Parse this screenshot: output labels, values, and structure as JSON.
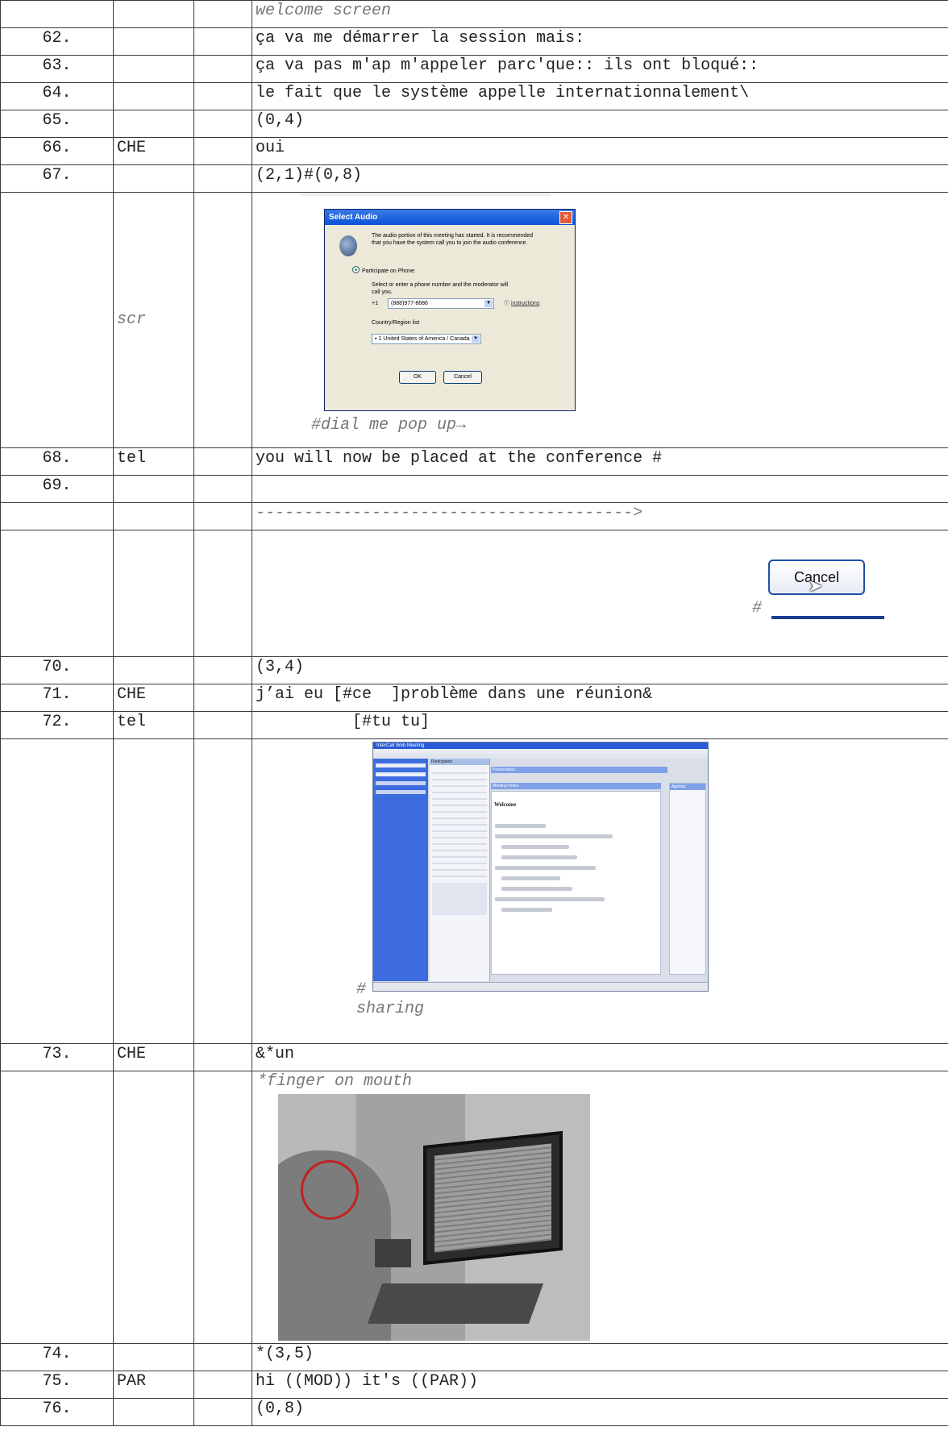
{
  "rows": {
    "r0": {
      "num": "",
      "spk": "",
      "text": "welcome screen"
    },
    "r62": {
      "num": "62.",
      "spk": "",
      "text": "ça va me démarrer la session mais:"
    },
    "r63": {
      "num": "63.",
      "spk": "",
      "text": "ça va pas m'ap m'appeler parc'que:: ils ont bloqué::"
    },
    "r64": {
      "num": "64.",
      "spk": "",
      "text": "le fait que le système appelle internationnalement\\"
    },
    "r65": {
      "num": "65.",
      "spk": "",
      "text": "(0,4)"
    },
    "r66": {
      "num": "66.",
      "spk": "CHE",
      "text": "oui"
    },
    "r67": {
      "num": "67.",
      "spk": "",
      "text": "(2,1)#(0,8)"
    },
    "scr": {
      "spk": "scr",
      "caption": "#dial me pop up→"
    },
    "r68": {
      "num": "68.",
      "spk": "tel",
      "text": "you will now be placed at the conference #"
    },
    "r69": {
      "num": "69.",
      "spk": "",
      "text": ""
    },
    "dash": {
      "text": "--------------------------------------->"
    },
    "cancel_mark": "#",
    "r70": {
      "num": "70.",
      "spk": "",
      "text": "(3,4)"
    },
    "r71": {
      "num": "71.",
      "spk": "CHE",
      "text": "j’ai eu [#ce  ]problème dans une réunion&"
    },
    "r72": {
      "num": "72.",
      "spk": "tel",
      "text": "          [#tu tu]"
    },
    "share": {
      "mark": "#",
      "caption": "sharing"
    },
    "r73": {
      "num": "73.",
      "spk": "CHE",
      "text": "&*un"
    },
    "photo": {
      "caption": "*finger on mouth"
    },
    "r74": {
      "num": "74.",
      "spk": "",
      "text": "*(3,5)"
    },
    "r75": {
      "num": "75.",
      "spk": "PAR",
      "text": "hi ((MOD)) it's ((PAR))"
    },
    "r76": {
      "num": "76.",
      "spk": "",
      "text": "(0,8)"
    }
  },
  "dialog": {
    "title": "Select Audio",
    "close": "✕",
    "message": "The audio portion of this meeting has started. It is recommended that you have the system call you to join the audio conference.",
    "radio_label": "Participate on Phone",
    "instruction": "Select or enter a phone number and the moderator will call you.",
    "prefix": "+1",
    "phone": "(888)977-8686",
    "help_link": "instructions",
    "country_label": "Country/Region list",
    "country": "1 United States of America / Canada",
    "ok": "OK",
    "cancel": "Cancel"
  },
  "cancel_button": {
    "label": "Cancel"
  },
  "shared_screen": {
    "window_title": "InterCall Web Meeting",
    "panel_title": "Participants",
    "doc_heading": "Welcome",
    "meeting_notes": "Meeting Notes",
    "presentation": "Presentation",
    "agenda": "Agenda"
  }
}
